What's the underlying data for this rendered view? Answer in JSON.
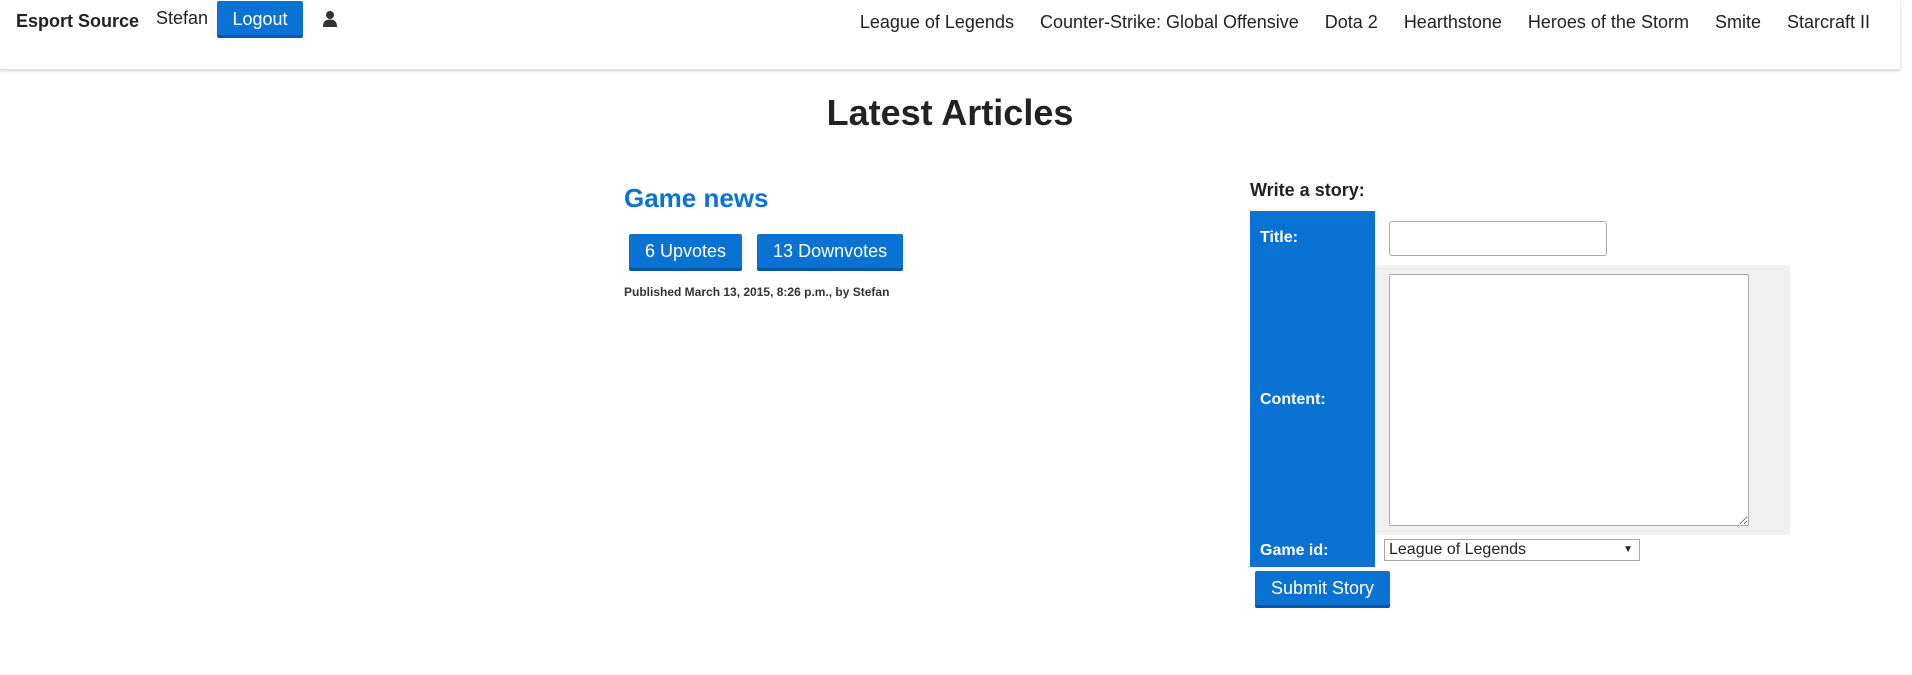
{
  "navbar": {
    "brand": "Esport Source",
    "username": "Stefan",
    "logout_label": "Logout",
    "user_icon": "user-icon",
    "links": [
      "League of Legends",
      "Counter-Strike: Global Offensive",
      "Dota 2",
      "Hearthstone",
      "Heroes of the Storm",
      "Smite",
      "Starcraft II"
    ]
  },
  "page": {
    "title": "Latest Articles"
  },
  "article": {
    "title": "Game news",
    "upvotes_label": "6 Upvotes",
    "downvotes_label": "13 Downvotes",
    "published": "Published March 13, 2015, 8:26 p.m., by Stefan"
  },
  "story_form": {
    "heading": "Write a story:",
    "title_label": "Title:",
    "title_value": "",
    "content_label": "Content:",
    "content_value": "",
    "game_label": "Game id:",
    "game_selected": "League of Legends",
    "submit_label": "Submit Story"
  },
  "colors": {
    "accent": "#0a72d3",
    "accent_dark": "#0657a3",
    "shaded_cell": "#f0f0f0"
  }
}
